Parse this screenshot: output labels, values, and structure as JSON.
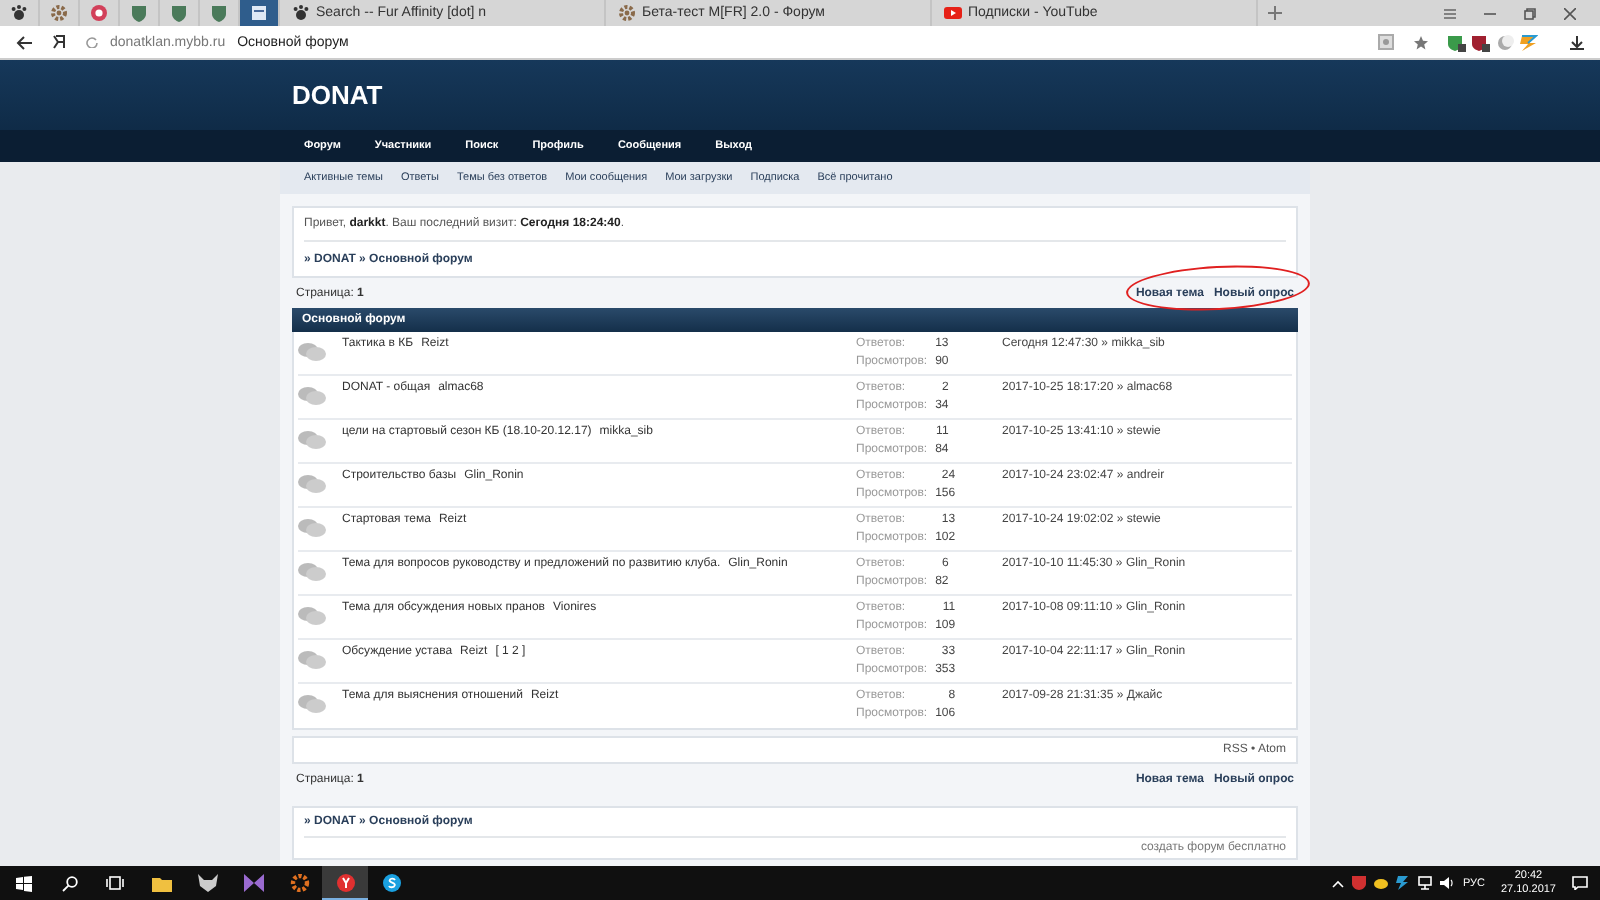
{
  "browser": {
    "tabs": [
      {
        "kind": "paw",
        "selected": false
      },
      {
        "kind": "gear",
        "selected": false
      },
      {
        "kind": "round",
        "selected": false
      },
      {
        "kind": "shield",
        "selected": false
      },
      {
        "kind": "shield",
        "selected": false
      },
      {
        "kind": "shield",
        "selected": false
      },
      {
        "kind": "page",
        "selected": true
      },
      {
        "kind": "paw",
        "label": "Search -- Fur Affinity [dot] n",
        "selected": false
      },
      {
        "kind": "gear",
        "label": "Бета-тест M[FR] 2.0 - Форум",
        "selected": false
      },
      {
        "kind": "video",
        "label": "Подписки - YouTube",
        "selected": false
      }
    ],
    "address": {
      "domain": "donatklan.mybb.ru",
      "title": "Основной форум"
    }
  },
  "forum": {
    "title": "DONAT",
    "nav": [
      "Форум",
      "Участники",
      "Поиск",
      "Профиль",
      "Сообщения",
      "Выход"
    ],
    "subnav": [
      "Активные темы",
      "Ответы",
      "Темы без ответов",
      "Мои сообщения",
      "Мои загрузки",
      "Подписка",
      "Всё прочитано"
    ],
    "welcome": "Привет, **darkkt**. Ваш последний визит: **Сегодня 18:24:40**.",
    "breadcrumb": "» DONAT » Основной форум",
    "pagination": "Страница: **1**",
    "actions": [
      "Новая тема",
      "Новый опрос"
    ],
    "highlight": true,
    "table_title": "Основной форум",
    "topics": [
      {
        "title": "Тактика в КБ",
        "author": "Reizt",
        "replies_label": "Ответов:",
        "replies": "13",
        "views_label": "Просмотров:",
        "views": "90",
        "last_post": "Сегодня 12:47:30 » mikka_sib"
      },
      {
        "title": "DONAT - общая",
        "author": "almac68",
        "replies_label": "Ответов:",
        "replies": "2",
        "views_label": "Просмотров:",
        "views": "34",
        "last_post": "2017-10-25 18:17:20 » almac68"
      },
      {
        "title": "цели на стартовый сезон КБ (18.10-20.12.17)",
        "author": "mikka_sib",
        "replies_label": "Ответов:",
        "replies": "11",
        "views_label": "Просмотров:",
        "views": "84",
        "last_post": "2017-10-25 13:41:10 » stewie"
      },
      {
        "title": "Строительство базы",
        "author": "Glin_Ronin",
        "replies_label": "Ответов:",
        "replies": "24",
        "views_label": "Просмотров:",
        "views": "156",
        "last_post": "2017-10-24 23:02:47 » andreir"
      },
      {
        "title": "Стартовая тема",
        "author": "Reizt",
        "replies_label": "Ответов:",
        "replies": "13",
        "views_label": "Просмотров:",
        "views": "102",
        "last_post": "2017-10-24 19:02:02 » stewie"
      },
      {
        "title": "Тема для вопросов руководству и предложений по развитию клуба.",
        "author": "Glin_Ronin",
        "replies_label": "Ответов:",
        "replies": "6",
        "views_label": "Просмотров:",
        "views": "82",
        "last_post": "2017-10-10 11:45:30 » Glin_Ronin"
      },
      {
        "title": "Тема для обсуждения новых пранов",
        "author": "Vionires",
        "replies_label": "Ответов:",
        "replies": "11",
        "views_label": "Просмотров:",
        "views": "109",
        "last_post": "2017-10-08 09:11:10 » Glin_Ronin"
      },
      {
        "title": "Обсуждение устава",
        "author": "Reizt",
        "pages": "[ 1 2 ]",
        "replies_label": "Ответов:",
        "replies": "33",
        "views_label": "Просмотров:",
        "views": "353",
        "last_post": "2017-10-04 22:11:17 » Glin_Ronin"
      },
      {
        "title": "Тема для выяснения отношений",
        "author": "Reizt",
        "replies_label": "Ответов:",
        "replies": "8",
        "views_label": "Просмотров:",
        "views": "106",
        "last_post": "2017-09-28 21:31:35 » Джайс"
      }
    ],
    "feeds": "RSS • Atom",
    "bottom_pagination": "Страница: **1**",
    "bottom_actions": [
      "Новая тема",
      "Новый опрос"
    ],
    "bottom_breadcrumb": "» DONAT » Основной форум",
    "footer_link": "создать форум бесплатно"
  },
  "taskbar": {
    "apps": [
      {
        "kind": "folder",
        "active": false
      },
      {
        "kind": "fox",
        "active": false
      },
      {
        "kind": "bow",
        "active": false
      },
      {
        "kind": "gear",
        "active": false
      },
      {
        "kind": "browser",
        "active": true
      },
      {
        "kind": "chat",
        "active": false
      }
    ],
    "language": "РУС",
    "time": "20:42",
    "date": "27.10.2017"
  }
}
